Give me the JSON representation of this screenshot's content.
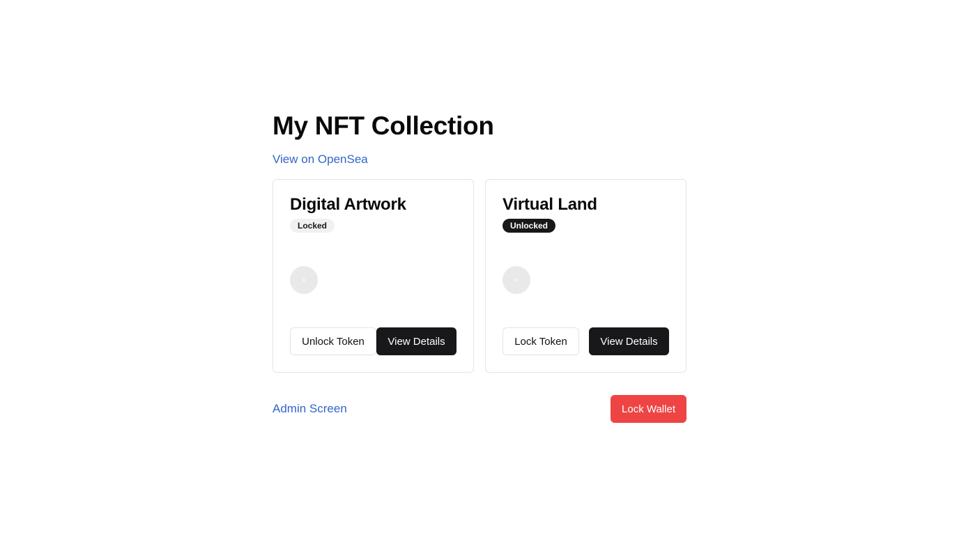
{
  "page": {
    "title": "My NFT Collection",
    "opensea_link": "View on OpenSea"
  },
  "cards": [
    {
      "title": "Digital Artwork",
      "status": "Locked",
      "toggle_label": "Unlock Token",
      "details_label": "View Details"
    },
    {
      "title": "Virtual Land",
      "status": "Unlocked",
      "toggle_label": "Lock Token",
      "details_label": "View Details"
    }
  ],
  "footer": {
    "admin_link": "Admin Screen",
    "lock_wallet_label": "Lock Wallet"
  },
  "colors": {
    "link": "#3166c7",
    "primary_dark": "#18181b",
    "danger": "#ef4444",
    "border": "#e4e4e7"
  }
}
